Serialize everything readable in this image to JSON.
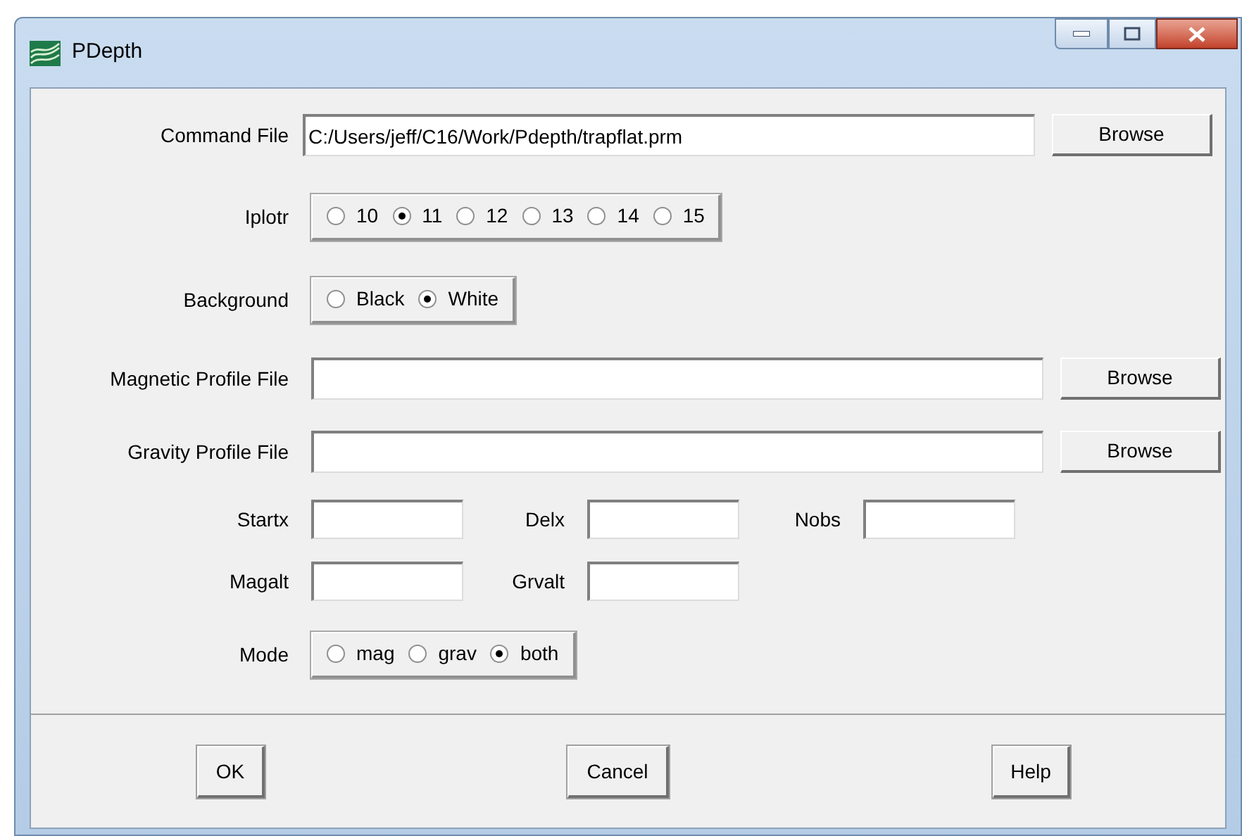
{
  "window": {
    "title": "PDepth"
  },
  "rows": [
    {
      "kind": "file",
      "label": "Command File",
      "value": "C:/Users/jeff/C16/Work/Pdepth/trapflat.prm",
      "button": "Browse"
    },
    {
      "kind": "radio",
      "label": "Iplotr",
      "options": [
        {
          "label": "10",
          "selected": false
        },
        {
          "label": "11",
          "selected": true
        },
        {
          "label": "12",
          "selected": false
        },
        {
          "label": "13",
          "selected": false
        },
        {
          "label": "14",
          "selected": false
        },
        {
          "label": "15",
          "selected": false
        }
      ]
    },
    {
      "kind": "radio",
      "label": "Background",
      "options": [
        {
          "label": "Black",
          "selected": false
        },
        {
          "label": "White",
          "selected": true
        }
      ]
    },
    {
      "kind": "file",
      "label": "Magnetic Profile File",
      "button": "Browse"
    },
    {
      "kind": "file",
      "label": "Gravity Profile File",
      "button": "Browse"
    },
    {
      "kind": "fields",
      "fields": [
        {
          "label": "Startx"
        },
        {
          "label": "Delx"
        },
        {
          "label": "Nobs"
        }
      ]
    },
    {
      "kind": "fields",
      "fields": [
        {
          "label": "Magalt"
        },
        {
          "label": "Grvalt"
        }
      ]
    },
    {
      "kind": "radio",
      "label": "Mode",
      "options": [
        {
          "label": "mag",
          "selected": false
        },
        {
          "label": "grav",
          "selected": false
        },
        {
          "label": "both",
          "selected": true
        }
      ]
    }
  ],
  "buttons": [
    "OK",
    "Cancel",
    "Help"
  ]
}
